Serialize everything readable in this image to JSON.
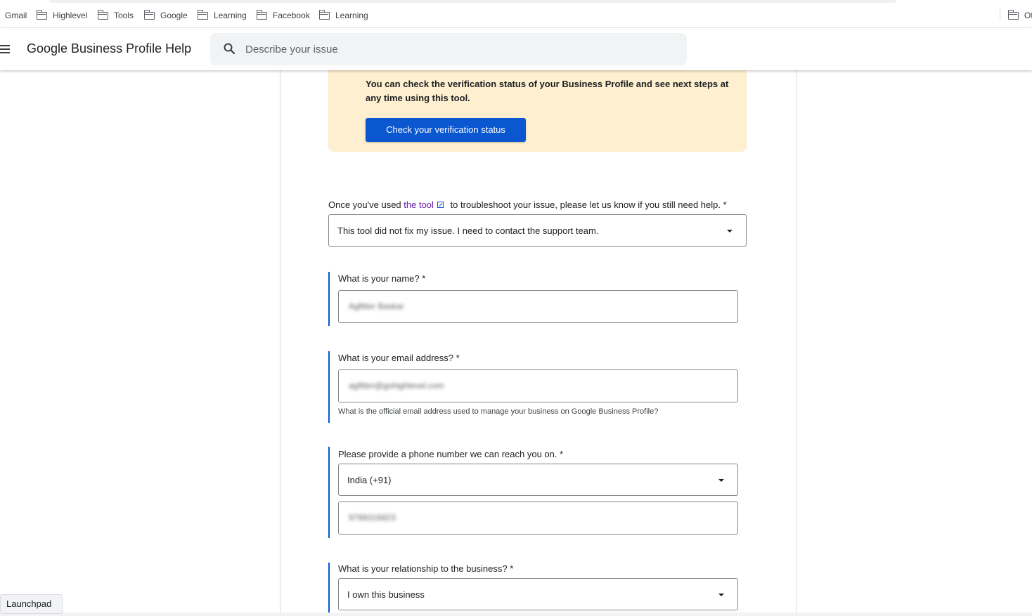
{
  "bookmarks": {
    "items": [
      {
        "label": "Gmail",
        "icon": "none"
      },
      {
        "label": "Highlevel",
        "icon": "folder-icon"
      },
      {
        "label": "Tools",
        "icon": "folder-icon"
      },
      {
        "label": "Google",
        "icon": "folder-icon"
      },
      {
        "label": "Learning",
        "icon": "folder-icon"
      },
      {
        "label": "Facebook",
        "icon": "folder-icon"
      },
      {
        "label": "Learning",
        "icon": "folder-icon"
      }
    ],
    "other_partial": "Ot"
  },
  "header": {
    "title": "Google Business Profile Help",
    "search_placeholder": "Describe your issue"
  },
  "banner": {
    "text": "You can check the verification status of your Business Profile and see next steps at any time using this tool.",
    "button_label": "Check your verification status",
    "background_color": "#fdefcf",
    "button_color": "#0b57d0"
  },
  "form": {
    "tool_question": {
      "prefix": "Once you've used ",
      "link_text": "the tool",
      "suffix": " to troubleshoot your issue, please let us know if you still need help. *",
      "selected": "This tool did not fix my issue. I need to contact the support team."
    },
    "name": {
      "label": "What is your name? *",
      "value": "Agfitter Baskar"
    },
    "email": {
      "label": "What is your email address? *",
      "value": "agfitter@gohighlevel.com",
      "helper": "What is the official email address used to manage your business on Google Business Profile?"
    },
    "phone": {
      "label": "Please provide a phone number we can  reach you on.  *",
      "country": "India (+91)",
      "value": "9789316823"
    },
    "relationship": {
      "label": "What is your relationship to the business? *",
      "selected": "I own this business"
    }
  },
  "footer": {
    "launchpad_label": "Launchpad"
  }
}
